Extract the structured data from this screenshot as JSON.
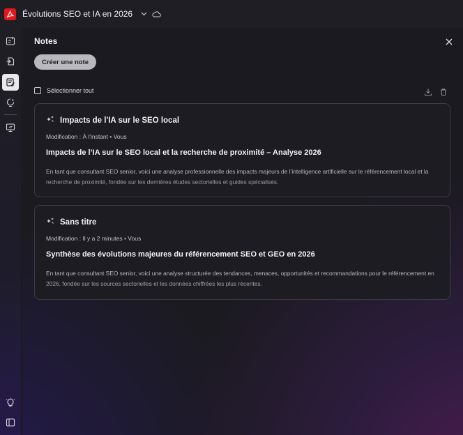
{
  "titlebar": {
    "doc_title": "Évolutions SEO et IA en 2026",
    "icons": [
      "acrobat-logo",
      "chevron-down-icon",
      "cloud-icon"
    ]
  },
  "sidebar": {
    "icons": [
      "edit-pdf-icon",
      "convert-icon",
      "notes-icon",
      "ai-assistant-icon",
      "present-icon",
      "tips-icon",
      "panel-toggle-icon"
    ],
    "active": "notes-icon"
  },
  "panel": {
    "title": "Notes",
    "create_label": "Créer une note",
    "select_all_label": "Sélectionner tout"
  },
  "notes": [
    {
      "title": "Impacts de l'IA sur le SEO local",
      "meta": "Modification : À l'instant  •  Vous",
      "heading": "Impacts de l’IA sur le SEO local et la recherche de proximité – Analyse 2026",
      "body": "En tant que consultant SEO senior, voici une analyse professionnelle des impacts majeurs de l’intelligence artificielle sur le référencement local et la recherche de proximité, fondée sur les dernières études sectorielles et guides spécialisés."
    },
    {
      "title": "Sans titre",
      "meta": "Modification : Il y a 2 minutes  •  Vous",
      "heading": "Synthèse des évolutions majeures du référencement SEO et GEO en 2026",
      "body": "En tant que consultant SEO senior, voici une analyse structurée des tendances, menaces, opportunités et recommandations pour le référencement en 2026, fondée sur les sources sectorielles et les données chiffrées les plus récentes."
    }
  ],
  "colors": {
    "brand": "#e3161b",
    "button_bg": "#b8b8bd",
    "card_border": "#3d3c44"
  }
}
